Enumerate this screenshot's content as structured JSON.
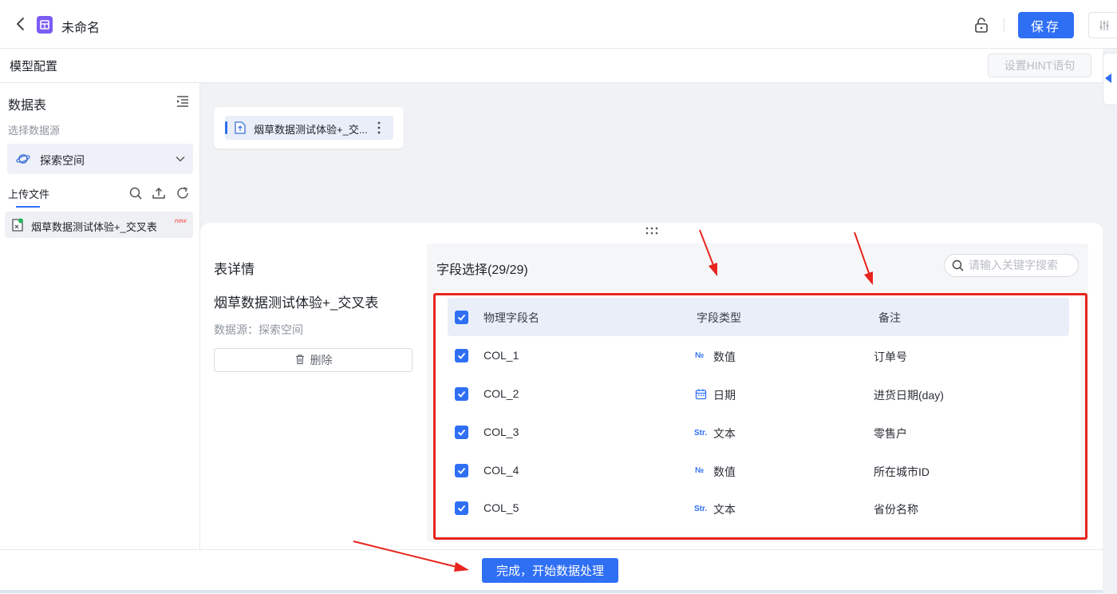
{
  "header": {
    "title": "未命名",
    "save_label": "保存"
  },
  "config": {
    "title": "模型配置",
    "hint_button": "设置HINT语句"
  },
  "sidebar": {
    "title": "数据表",
    "source_label": "选择数据源",
    "source_value": "探索空间",
    "upload_tab": "上传文件",
    "file_name": "烟草数据测试体验+_交叉表",
    "new_badge": "new"
  },
  "canvas": {
    "node_label": "烟草数据测试体验+_交..."
  },
  "detail": {
    "heading": "表详情",
    "table_name": "烟草数据测试体验+_交叉表",
    "source": "数据源：探索空间",
    "delete_label": "删除"
  },
  "fields": {
    "title": "字段选择(29/29)",
    "search_placeholder": "请输入关键字搜索",
    "columns": [
      "物理字段名",
      "字段类型",
      "备注"
    ],
    "rows": [
      {
        "name": "COL_1",
        "type_icon": "№",
        "type": "数值",
        "note": "订单号",
        "checked": true
      },
      {
        "name": "COL_2",
        "type_icon": "calendar-icon",
        "type": "日期",
        "note": "进货日期(day)",
        "checked": true
      },
      {
        "name": "COL_3",
        "type_icon": "Str.",
        "type": "文本",
        "note": "零售户",
        "checked": true
      },
      {
        "name": "COL_4",
        "type_icon": "№",
        "type": "数值",
        "note": "所在城市ID",
        "checked": true
      },
      {
        "name": "COL_5",
        "type_icon": "Str.",
        "type": "文本",
        "note": "省份名称",
        "checked": true
      }
    ]
  },
  "footer": {
    "finish_label": "完成，开始数据处理"
  },
  "colors": {
    "accent": "#2f6ff4",
    "annotation": "#e8241c"
  }
}
